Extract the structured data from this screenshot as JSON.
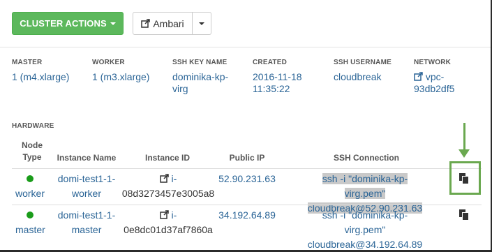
{
  "toolbar": {
    "cluster_actions_label": "CLUSTER ACTIONS",
    "ambari_label": "Ambari"
  },
  "info": {
    "master": {
      "label": "MASTER",
      "value": "1 (m4.xlarge)"
    },
    "worker": {
      "label": "WORKER",
      "value": "1 (m3.xlarge)"
    },
    "ssh_key": {
      "label": "SSH KEY NAME",
      "line1": "dominika-kp-",
      "line2": "virg"
    },
    "created": {
      "label": "CREATED",
      "line1": "2016-11-18",
      "line2": "11:35:22"
    },
    "ssh_user": {
      "label": "SSH USERNAME",
      "value": "cloudbreak"
    },
    "network": {
      "label": "NETWORK",
      "line1": "vpc-",
      "line2": "93db2df5"
    }
  },
  "hardware": {
    "title": "HARDWARE",
    "columns": {
      "node_type_1": "Node",
      "node_type_2": "Type",
      "instance_name": "Instance Name",
      "instance_id": "Instance ID",
      "public_ip": "Public IP",
      "ssh_connection": "SSH Connection"
    },
    "rows": [
      {
        "node_type": "worker",
        "name1": "domi-test1-1-",
        "name2": "worker",
        "id1": "i-",
        "id2": "08d3273457e3005a8",
        "ip": "52.90.231.63",
        "ssh1": "ssh -i \"dominika-kp-virg.pem\"",
        "ssh2": "cloudbreak@52.90.231.63",
        "selected": true
      },
      {
        "node_type": "master",
        "name1": "domi-test1-1-",
        "name2": "master",
        "id1": "i-",
        "id2": "0e8dc01d37af7860a",
        "ip": "34.192.64.89",
        "ssh1": "ssh -i \"dominika-kp-virg.pem\"",
        "ssh2": "cloudbreak@34.192.64.89",
        "selected": false
      }
    ]
  },
  "colors": {
    "accent_green": "#5cb85c",
    "link": "#2a6496",
    "status_dot": "#1a9c1a",
    "annotation": "#6aa84f"
  },
  "icons": {
    "external_link": "external-link-icon",
    "copy": "clipboard-copy-icon",
    "status": "status-dot-icon"
  }
}
